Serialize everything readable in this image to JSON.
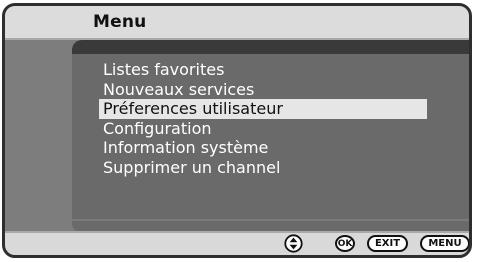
{
  "header": {
    "title": "Menu"
  },
  "menu": {
    "items": [
      {
        "label": "Listes favorites",
        "selected": false
      },
      {
        "label": "Nouveaux services",
        "selected": false
      },
      {
        "label": "Préferences utilisateur",
        "selected": true
      },
      {
        "label": "Configuration",
        "selected": false
      },
      {
        "label": "Information système",
        "selected": false
      },
      {
        "label": "Supprimer un channel",
        "selected": false
      }
    ]
  },
  "footer": {
    "navigate_icon": "up-down-arrows-icon",
    "ok_label": "OK",
    "exit_label": "EXIT",
    "menu_label": "MENU"
  },
  "colors": {
    "background": "#7d7d7d",
    "panel": "#6a6a6a",
    "highlight": "#e6e6e6",
    "bar": "#dcdcdc"
  }
}
